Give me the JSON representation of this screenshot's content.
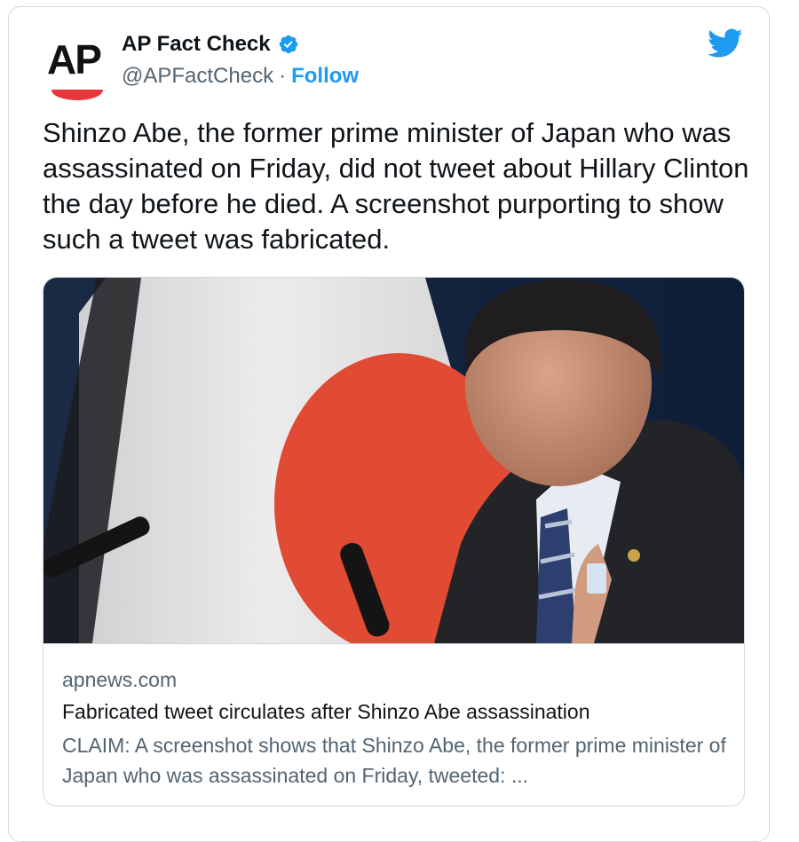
{
  "author": {
    "display_name": "AP Fact Check",
    "handle": "@APFactCheck",
    "separator": "·",
    "follow_label": "Follow",
    "avatar_text": "AP"
  },
  "tweet": {
    "text": "Shinzo Abe, the former prime minister of Japan who was assassinated on Friday, did not tweet about Hillary Clinton the day before he died. A screenshot purporting to show such a tweet was fabricated."
  },
  "link_card": {
    "domain": "apnews.com",
    "title": "Fabricated tweet circulates after Shinzo Abe assassination",
    "description": "CLAIM: A screenshot shows that Shinzo Abe, the former prime minister of Japan who was assassinated on Friday, tweeted: ..."
  },
  "colors": {
    "twitter_blue": "#1d9bf0",
    "ap_red": "#e8363a",
    "muted_text": "#536471"
  },
  "icons": [
    "verified-badge-icon",
    "twitter-bird-icon"
  ]
}
